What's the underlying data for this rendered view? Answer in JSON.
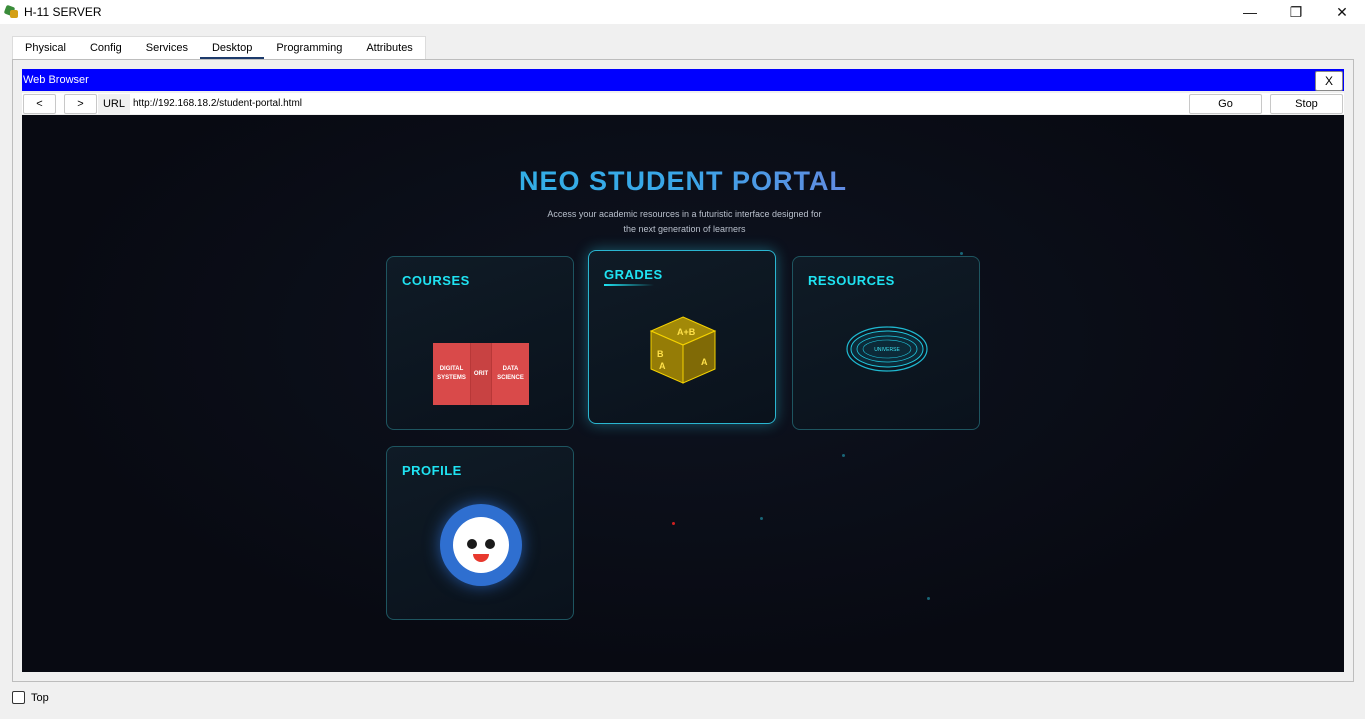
{
  "window": {
    "title": "H-11 SERVER"
  },
  "tabs": [
    {
      "label": "Physical"
    },
    {
      "label": "Config"
    },
    {
      "label": "Services"
    },
    {
      "label": "Desktop"
    },
    {
      "label": "Programming"
    },
    {
      "label": "Attributes"
    }
  ],
  "browser": {
    "title": "Web Browser",
    "close_label": "X",
    "back_label": "<",
    "forward_label": ">",
    "url_label": "URL",
    "url": "http://192.168.18.2/student-portal.html",
    "go_label": "Go",
    "stop_label": "Stop"
  },
  "portal": {
    "title": "NEO STUDENT PORTAL",
    "subtitle_line1": "Access your academic resources in a futuristic interface designed for",
    "subtitle_line2": "the next generation of learners",
    "cards": {
      "courses": {
        "title": "COURSES",
        "book_left": "DIGITAL SYSTEMS",
        "book_mid": "ORIT",
        "book_right": "DATA SCIENCE"
      },
      "grades": {
        "title": "GRADES"
      },
      "resources": {
        "title": "RESOURCES",
        "planet_text": "UNIVERSE"
      },
      "profile": {
        "title": "PROFILE"
      }
    }
  },
  "footer": {
    "top_label": "Top",
    "top_checked": false
  },
  "colors": {
    "browser_bar": "#0000ff",
    "card_title": "#1fe3f2",
    "portal_bg": "#080a12"
  }
}
